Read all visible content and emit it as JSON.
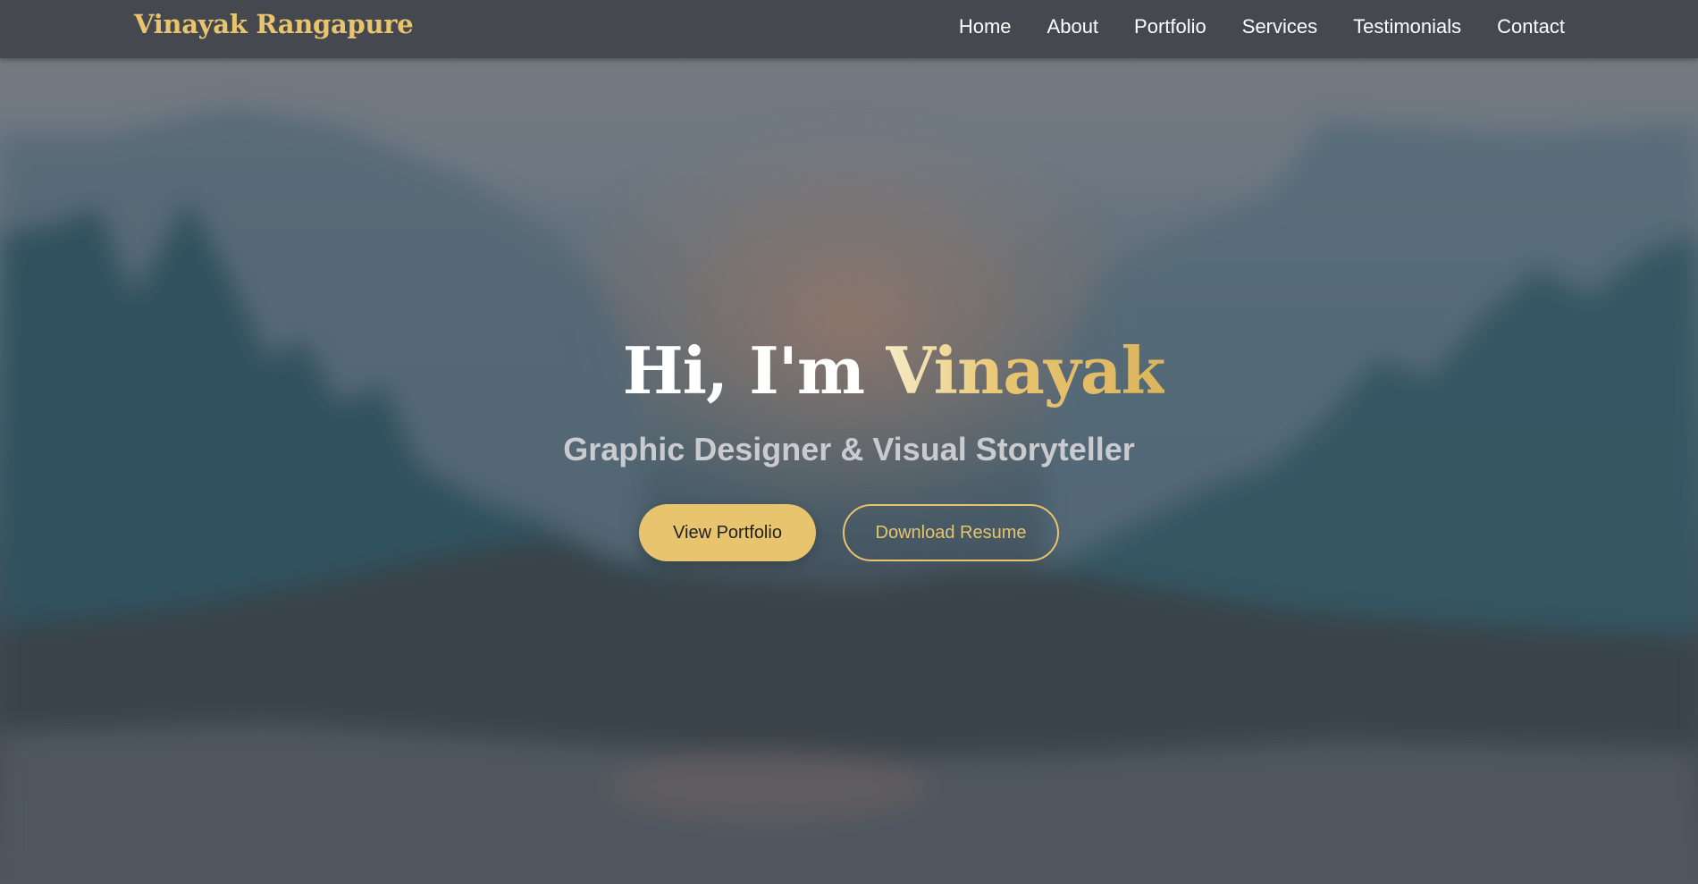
{
  "brand": {
    "name": "Vinayak Rangapure"
  },
  "nav": {
    "items": [
      {
        "label": "Home"
      },
      {
        "label": "About"
      },
      {
        "label": "Portfolio"
      },
      {
        "label": "Services"
      },
      {
        "label": "Testimonials"
      },
      {
        "label": "Contact"
      }
    ]
  },
  "hero": {
    "greeting": "Hi, I'm ",
    "name": "Vinayak",
    "subtitle": "Graphic Designer & Visual Storyteller",
    "primary_button": "View Portfolio",
    "secondary_button": "Download Resume"
  },
  "colors": {
    "accent": "#e8c46e",
    "navbar": "#45484f",
    "text": "#ffffff",
    "subtitle": "#c9cbcf"
  }
}
